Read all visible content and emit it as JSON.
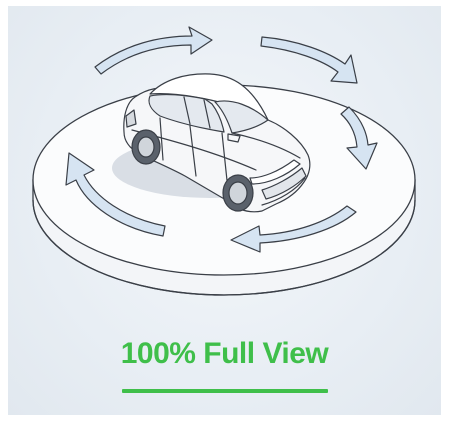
{
  "caption": {
    "text": "100% Full View",
    "color": "#3fbf4a"
  },
  "scene": {
    "vehicle": "sedan",
    "platform": "turntable",
    "rotation_arrows": [
      "arrow-top-left",
      "arrow-top-right",
      "arrow-right",
      "arrow-bottom",
      "arrow-left"
    ]
  },
  "colors": {
    "background": "#e9eff5",
    "platform_fill": "#ffffff",
    "arrow_fill": "#d6e4f2",
    "stroke": "#3a3f47"
  }
}
